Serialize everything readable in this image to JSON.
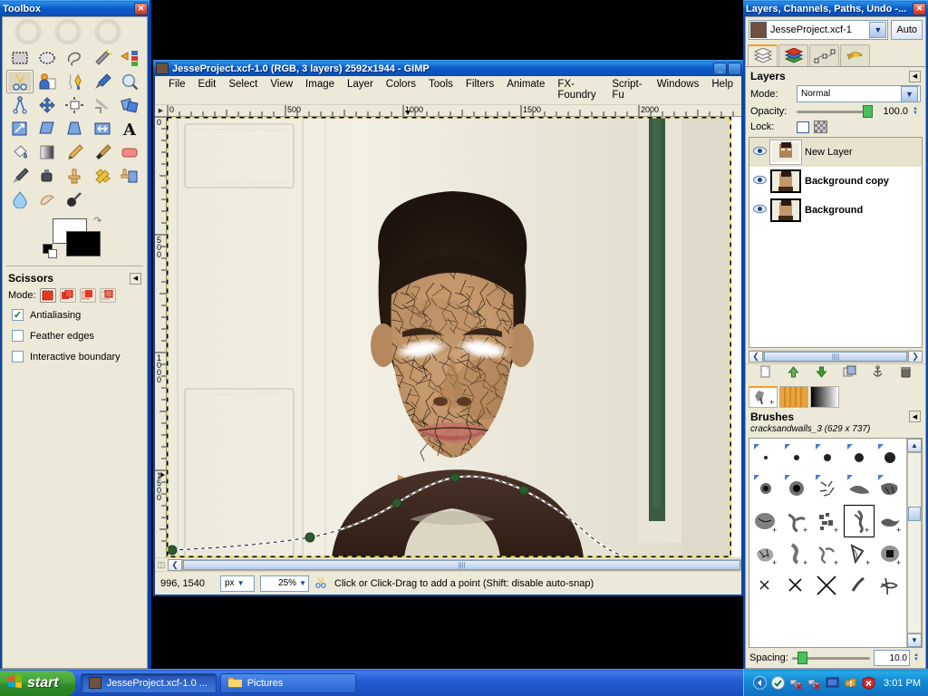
{
  "toolbox": {
    "title": "Toolbox",
    "close_label": "✕",
    "tools": [
      {
        "name": "rect-select-tool",
        "label": "Rectangle Select"
      },
      {
        "name": "ellipse-select-tool",
        "label": "Ellipse Select"
      },
      {
        "name": "free-select-tool",
        "label": "Free Select"
      },
      {
        "name": "fuzzy-select-tool",
        "label": "Fuzzy Select"
      },
      {
        "name": "select-by-color-tool",
        "label": "Select by Color"
      },
      {
        "name": "scissors-select-tool",
        "label": "Scissors Select"
      },
      {
        "name": "foreground-select-tool",
        "label": "Foreground Select"
      },
      {
        "name": "paths-tool",
        "label": "Paths"
      },
      {
        "name": "color-picker-tool",
        "label": "Color Picker"
      },
      {
        "name": "zoom-tool",
        "label": "Zoom"
      },
      {
        "name": "measure-tool",
        "label": "Measure"
      },
      {
        "name": "move-tool",
        "label": "Move"
      },
      {
        "name": "align-tool",
        "label": "Alignment"
      },
      {
        "name": "crop-tool",
        "label": "Crop"
      },
      {
        "name": "rotate-tool",
        "label": "Rotate"
      },
      {
        "name": "scale-tool",
        "label": "Scale"
      },
      {
        "name": "shear-tool",
        "label": "Shear"
      },
      {
        "name": "perspective-tool",
        "label": "Perspective"
      },
      {
        "name": "flip-tool",
        "label": "Flip"
      },
      {
        "name": "text-tool",
        "label": "Text"
      },
      {
        "name": "bucket-fill-tool",
        "label": "Bucket Fill"
      },
      {
        "name": "gradient-tool",
        "label": "Blend"
      },
      {
        "name": "pencil-tool",
        "label": "Pencil"
      },
      {
        "name": "paintbrush-tool",
        "label": "Paintbrush"
      },
      {
        "name": "eraser-tool",
        "label": "Eraser"
      },
      {
        "name": "airbrush-tool",
        "label": "Airbrush"
      },
      {
        "name": "ink-tool",
        "label": "Ink"
      },
      {
        "name": "clone-tool",
        "label": "Clone"
      },
      {
        "name": "heal-tool",
        "label": "Heal"
      },
      {
        "name": "perspective-clone-tool",
        "label": "Perspective Clone"
      },
      {
        "name": "blur-sharpen-tool",
        "label": "Blur / Sharpen"
      },
      {
        "name": "smudge-tool",
        "label": "Smudge"
      },
      {
        "name": "dodge-burn-tool",
        "label": "Dodge / Burn"
      }
    ],
    "selected_tool_index": 5,
    "colors": {
      "foreground": "#ffffff",
      "background": "#000000"
    },
    "options": {
      "title": "Scissors",
      "mode_label": "Mode:",
      "mode_selected_index": 0,
      "checkboxes": [
        {
          "label": "Antialiasing",
          "checked": true
        },
        {
          "label": "Feather edges",
          "checked": false
        },
        {
          "label": "Interactive boundary",
          "checked": false
        }
      ]
    }
  },
  "image_window": {
    "title": "JesseProject.xcf-1.0 (RGB, 3 layers) 2592x1944 - GIMP",
    "minimize_label": "_",
    "maximize_label": "□",
    "menu": [
      {
        "label": "File",
        "accel": "F"
      },
      {
        "label": "Edit",
        "accel": "E"
      },
      {
        "label": "Select",
        "accel": "S"
      },
      {
        "label": "View",
        "accel": "V"
      },
      {
        "label": "Image",
        "accel": "I"
      },
      {
        "label": "Layer",
        "accel": "L"
      },
      {
        "label": "Colors",
        "accel": "C"
      },
      {
        "label": "Tools",
        "accel": "T"
      },
      {
        "label": "Filters",
        "accel": "r"
      },
      {
        "label": "Animate",
        "accel": ""
      },
      {
        "label": "FX-Foundry",
        "accel": ""
      },
      {
        "label": "Script-Fu",
        "accel": ""
      },
      {
        "label": "Windows",
        "accel": "W"
      },
      {
        "label": "Help",
        "accel": "H"
      }
    ],
    "ruler_h_labels": [
      "0",
      "500",
      "1000",
      "1500",
      "2000"
    ],
    "ruler_v_labels": [
      "0",
      "500",
      "1000",
      "1500"
    ],
    "statusbar": {
      "position": "996, 1540",
      "unit": "px",
      "zoom": "25%",
      "hint": "Click or Click-Drag to add a point (Shift: disable auto-snap)"
    }
  },
  "dock": {
    "title": "Layers, Channels, Paths, Undo -...",
    "close_label": "✕",
    "image_name": "JesseProject.xcf-1",
    "auto_label": "Auto",
    "tabs": [
      {
        "name": "layers-tab",
        "label": "Layers"
      },
      {
        "name": "channels-tab",
        "label": "Channels"
      },
      {
        "name": "paths-tab",
        "label": "Paths"
      },
      {
        "name": "undo-history-tab",
        "label": "Undo History"
      }
    ],
    "selected_tab_index": 0,
    "layers_panel": {
      "title": "Layers",
      "mode_label": "Mode:",
      "mode_value": "Normal",
      "opacity_label": "Opacity:",
      "opacity_value": "100.0",
      "lock_label": "Lock:",
      "layers": [
        {
          "name": "New Layer",
          "visible": true,
          "selected": true,
          "bold": false
        },
        {
          "name": "Background copy",
          "visible": true,
          "selected": false,
          "bold": true
        },
        {
          "name": "Background",
          "visible": true,
          "selected": false,
          "bold": true
        }
      ],
      "buttons": [
        {
          "name": "new-layer-button",
          "label": "New Layer"
        },
        {
          "name": "raise-layer-button",
          "label": "Raise Layer"
        },
        {
          "name": "lower-layer-button",
          "label": "Lower Layer"
        },
        {
          "name": "duplicate-layer-button",
          "label": "Duplicate Layer"
        },
        {
          "name": "anchor-layer-button",
          "label": "Anchor Layer"
        },
        {
          "name": "delete-layer-button",
          "label": "Delete Layer"
        }
      ]
    },
    "brushes_panel": {
      "tabs": [
        {
          "name": "brushes-tab",
          "label": "Brushes"
        },
        {
          "name": "patterns-tab",
          "label": "Patterns"
        },
        {
          "name": "gradients-tab",
          "label": "Gradients"
        }
      ],
      "selected_tab_index": 0,
      "title": "Brushes",
      "selected_brush": "cracksandwalls_3 (629 x 737)",
      "selected_brush_index": 18,
      "spacing_label": "Spacing:",
      "spacing_value": "10.0"
    }
  },
  "taskbar": {
    "start_label": "start",
    "buttons": [
      {
        "name": "taskbar-item-gimp",
        "label": "JesseProject.xcf-1.0 ...",
        "active": true
      },
      {
        "name": "taskbar-item-pictures",
        "label": "Pictures",
        "active": false
      }
    ],
    "clock": "3:01 PM"
  },
  "colors": {
    "xp_blue": "#0a47a8",
    "panel_beige": "#ece9d8",
    "selection_green": "#2d5a2d",
    "accent_orange": "#f0a02a"
  }
}
